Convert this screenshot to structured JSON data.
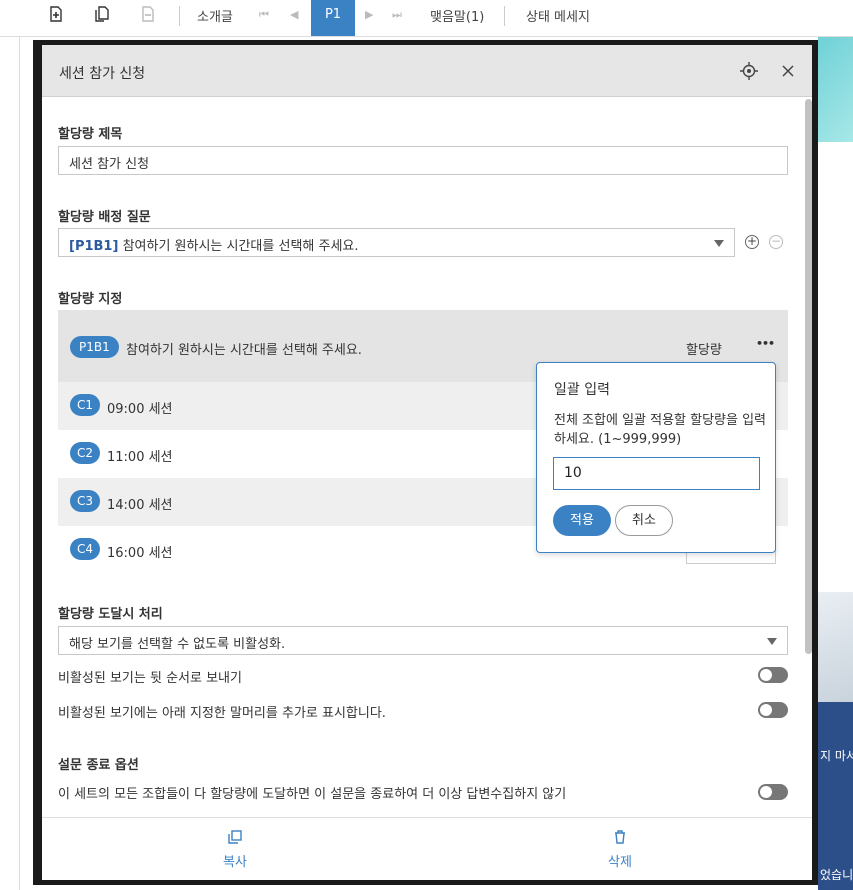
{
  "toolbar": {
    "intro_label": "소개글",
    "page_label": "P1",
    "closing_label": "맺음말(1)",
    "status_label": "상태 메세지"
  },
  "background": {
    "right_text_1": "지 마서",
    "right_text_2": "었습니"
  },
  "dialog": {
    "title": "세션 참가 신청",
    "quota_title_label": "할당량 제목",
    "quota_title_value": "세션 참가 신청",
    "quota_question_label": "할당량 배정 질문",
    "question_code": "[P1B1]",
    "question_text": "참여하기 원하시는 시간대를 선택해 주세요.",
    "quota_assign_label": "할당량 지정",
    "alloc_header": {
      "code": "P1B1",
      "text": "참여하기 원하시는 시간대를 선택해 주세요.",
      "quota_col": "할당량",
      "more": "•••"
    },
    "alloc_rows": [
      {
        "code": "C1",
        "label": "09:00 세션"
      },
      {
        "code": "C2",
        "label": "11:00 세션"
      },
      {
        "code": "C3",
        "label": "14:00 세션"
      },
      {
        "code": "C4",
        "label": "16:00 세션"
      }
    ],
    "reach_label": "할당량 도달시 처리",
    "reach_value": "해당 보기를 선택할 수 없도록 비활성화.",
    "opt_send_back": "비활성된 보기는 뒷 순서로 보내기",
    "opt_show_note": "비활성된 보기에는 아래 지정한 말머리를 추가로 표시합니다.",
    "end_label": "설문 종료 옵션",
    "opt_end": "이 세트의 모든 조합들이 다 할당량에 도달하면 이 설문을 종료하여 더 이상 답변수집하지 않기",
    "footer": {
      "copy": "복사",
      "delete": "삭제"
    }
  },
  "popover": {
    "title": "일괄 입력",
    "desc": "전체 조합에 일괄 적용할 할당량을 입력하세요. (1~999,999)",
    "value": "10",
    "apply": "적용",
    "cancel": "취소"
  },
  "colors": {
    "accent": "#3b82c4",
    "header_bg": "#e6e6e6"
  }
}
